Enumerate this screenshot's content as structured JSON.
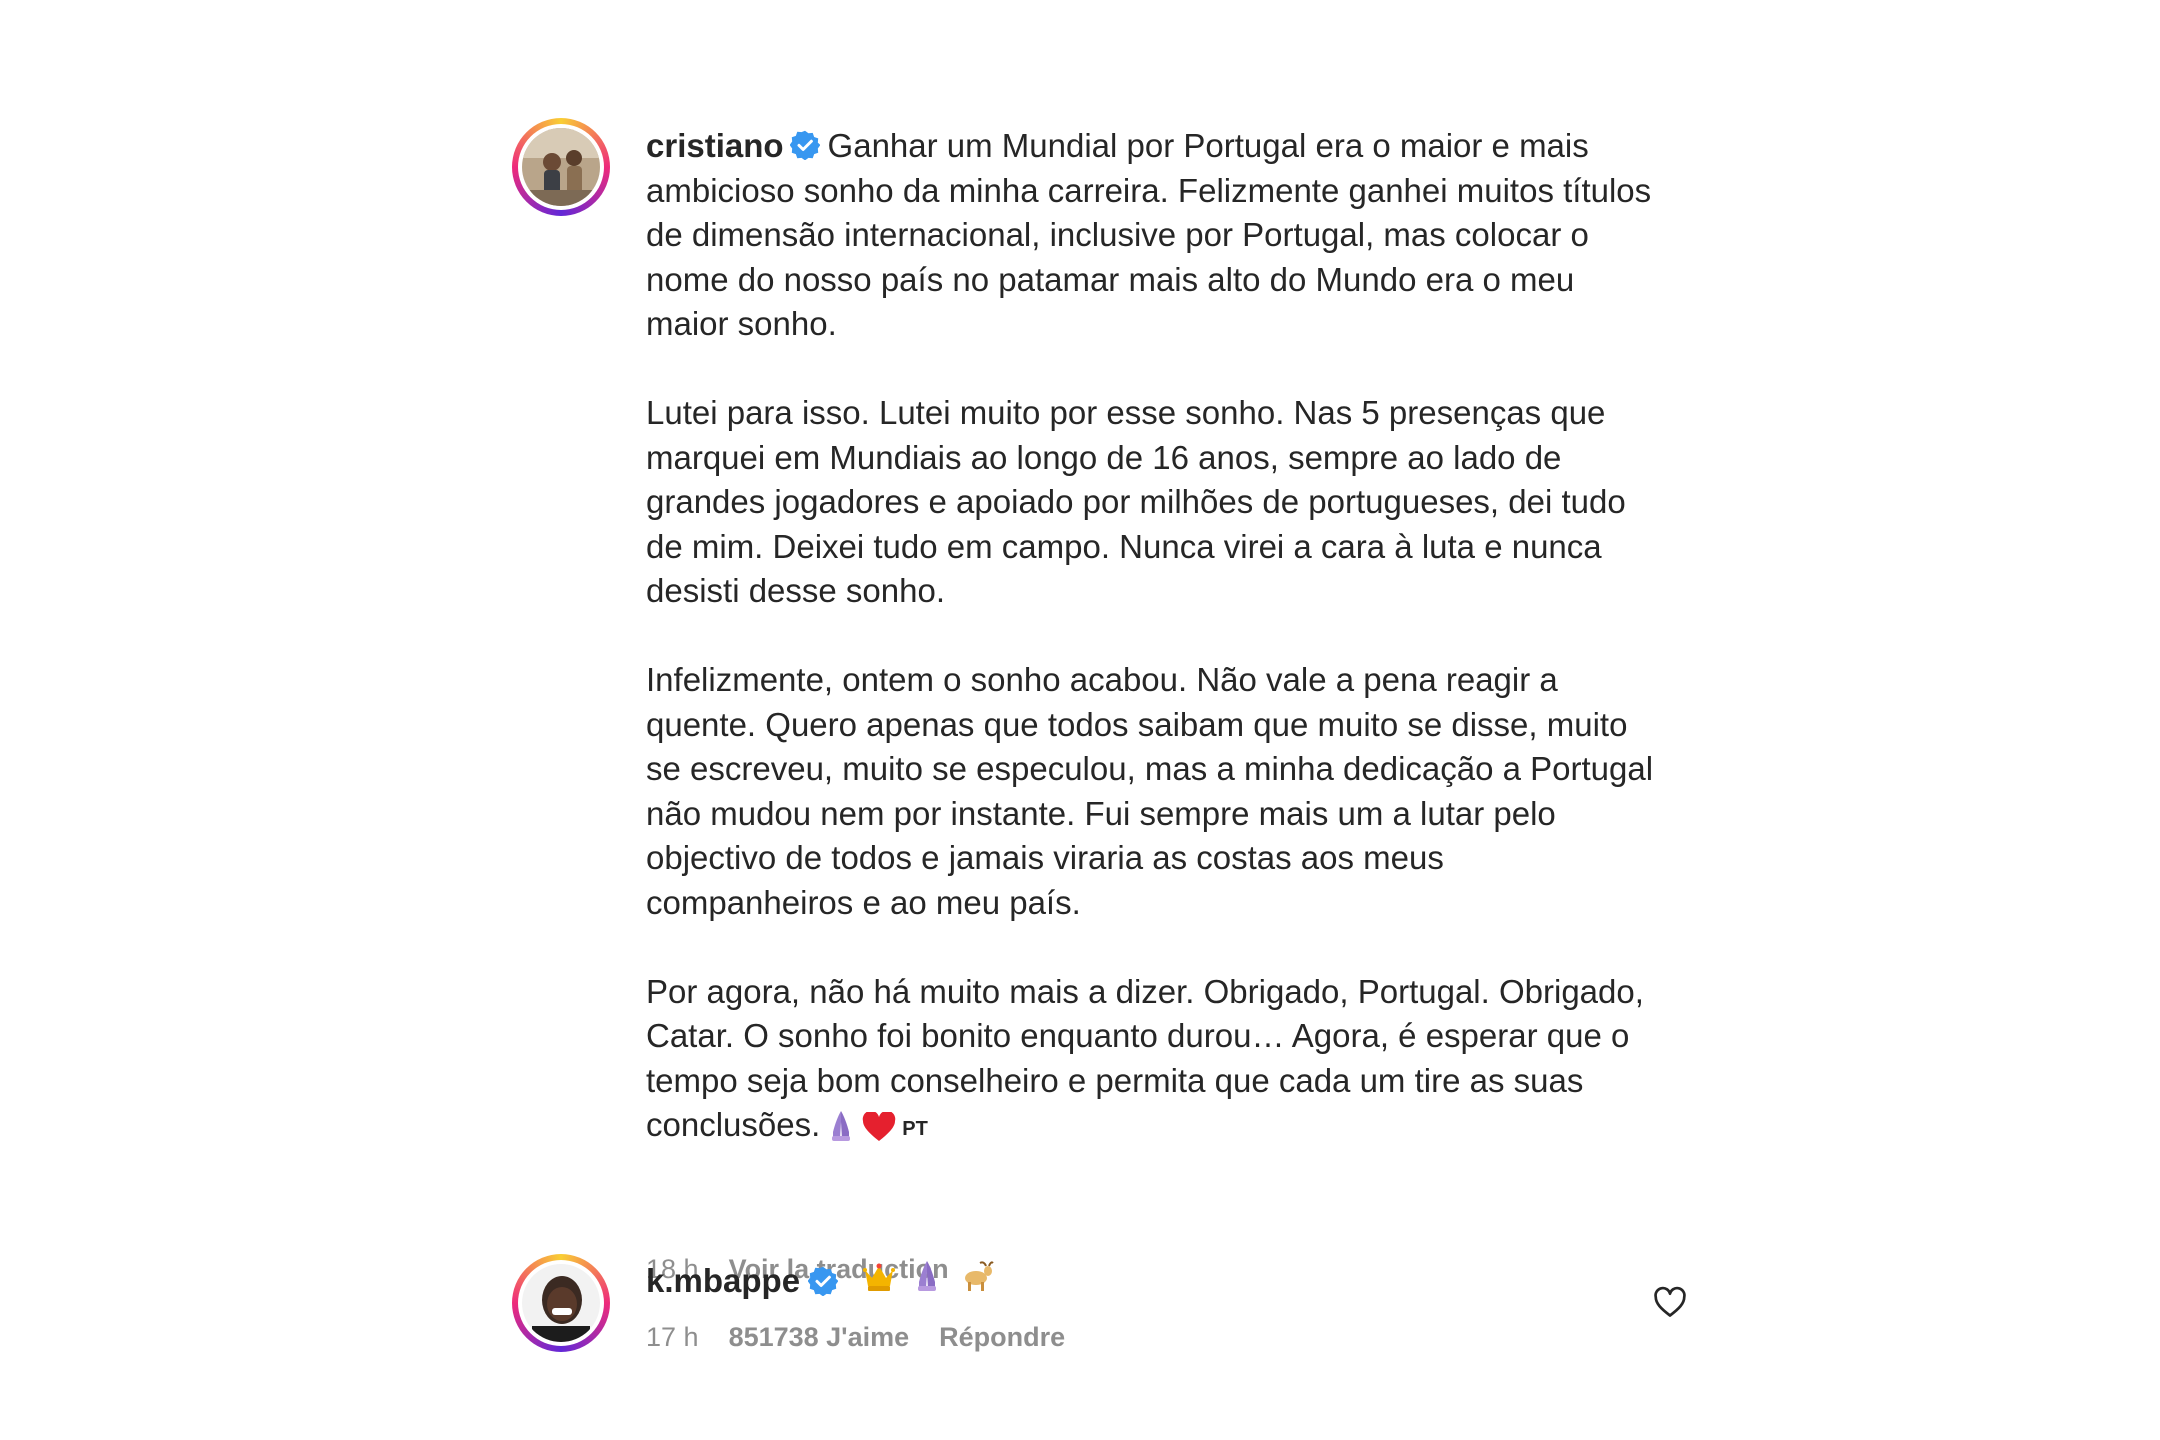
{
  "caption": {
    "username": "cristiano",
    "paragraphs": [
      "Ganhar um Mundial por Portugal era o maior e mais ambicioso sonho da minha carreira. Felizmente ganhei muitos títulos de dimensão internacional, inclusive por Portugal, mas colocar o nome do nosso país no patamar mais alto do Mundo era o meu maior sonho.",
      "Lutei para isso. Lutei muito por esse sonho. Nas 5 presenças que marquei em Mundiais ao longo de 16 anos, sempre ao lado de grandes jogadores e apoiado por milhões de portugueses, dei tudo de mim. Deixei tudo em campo. Nunca virei a cara à luta e nunca desisti desse sonho.",
      "Infelizmente, ontem o sonho acabou. Não vale a pena reagir a quente. Quero apenas que todos saibam que muito se disse, muito se escreveu, muito se especulou, mas a minha dedicação a Portugal não mudou nem por instante. Fui sempre mais um a lutar pelo objectivo de todos e jamais viraria as costas aos meus companheiros e ao meu país.",
      "Por agora, não há muito mais a dizer. Obrigado, Portugal. Obrigado, Catar. O sonho foi bonito enquanto durou… Agora, é esperar que o tempo seja bom conselheiro e permita que cada um tire as suas conclusões."
    ],
    "emojis": [
      "praying-hands-emoji",
      "red-heart-emoji"
    ],
    "lang_tag": "PT",
    "time": "18 h",
    "translate_label": "Voir la traduction"
  },
  "comment": {
    "username": "k.mbappe",
    "emojis": [
      "crown-emoji",
      "praying-hands-emoji",
      "goat-emoji"
    ],
    "time": "17 h",
    "likes": "851738 J'aime",
    "reply_label": "Répondre"
  },
  "colors": {
    "text": "#262626",
    "secondary": "#8e8e8e",
    "verified": "#3897f0",
    "heart": "#ed4956"
  }
}
